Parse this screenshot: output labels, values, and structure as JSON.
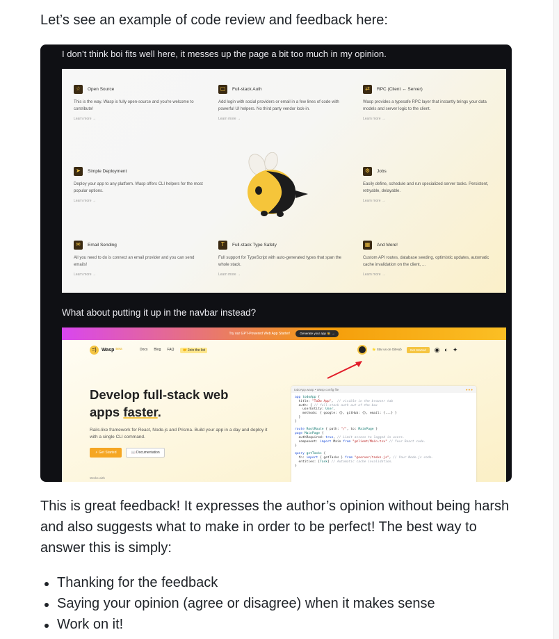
{
  "intro": "Let’s see an example of code review and feedback here:",
  "screenshot": {
    "comment1": "I don’t think boi fits well here, it messes up the page a bit too much in my opinion.",
    "comment2": "What about putting it up in the navbar instead?",
    "features": [
      {
        "icon": "star-icon",
        "glyph": "☆",
        "title": "Open Source",
        "desc": "This is the way. Wasp is fully open-source and you're welcome to contribute!",
        "more": "Learn more →"
      },
      {
        "icon": "lock-icon",
        "glyph": "▢",
        "title": "Full-stack Auth",
        "desc": "Add login with social providers or email in a few lines of code with powerful UI helpers. No third party vendor lock-in.",
        "more": "Learn more →"
      },
      {
        "icon": "rpc-icon",
        "glyph": "⇄",
        "title": "RPC (Client ↔ Server)",
        "desc": "Wasp provides a typesafe RPC layer that instantly brings your data models and server logic to the client.",
        "more": "Learn more →"
      },
      {
        "icon": "send-icon",
        "glyph": "➤",
        "title": "Simple Deployment",
        "desc": "Deploy your app to any platform. Wasp offers CLI helpers for the most popular options.",
        "more": "Learn more →"
      },
      {
        "icon": "gear-icon",
        "glyph": "⚙",
        "title": "Jobs",
        "desc": "Easily define, schedule and run specialized server tasks. Persistent, retryable, delayable.",
        "more": "Learn more →"
      },
      {
        "icon": "mail-icon",
        "glyph": "✉",
        "title": "Email Sending",
        "desc": "All you need to do is connect an email provider and you can send emails!",
        "more": "Learn more →"
      },
      {
        "icon": "type-icon",
        "glyph": "T",
        "title": "Full-stack Type Safety",
        "desc": "Full support for TypeScript with auto-generated types that span the whole stack.",
        "more": "Learn more →"
      },
      {
        "icon": "grid-icon",
        "glyph": "▦",
        "title": "And More!",
        "desc": "Custom API routes, database seeding, optimistic updates, automatic cache invalidation on the client, ...",
        "more": "Learn more →"
      }
    ],
    "navbar": {
      "banner_text": "Try our GPT-Powered Web App Starter!",
      "banner_button": "Generate your app 🐝 →",
      "logo_name": "Wasp",
      "logo_beta": "Beta",
      "links": [
        "Docs",
        "Blog",
        "FAQ"
      ],
      "join": "🤝 Join the list",
      "star": "⭐ Star us on GitHub",
      "get_started": "Get Started",
      "socials": "◉ ◐ ✦"
    },
    "hero": {
      "title_line1": "Develop full-stack web",
      "title_line2": "apps ",
      "title_underlined": "faster",
      "title_end": ".",
      "subtitle": "Rails-like framework for React, Node.js and Prisma. Build your app in a day and deploy it with a single CLI command.",
      "get_started": "⚡ Get Started",
      "documentation": "📖 Documentation",
      "works_with": "Works with"
    },
    "code": {
      "filename": "todoApp.wasp • Wasp config file",
      "dots": "●●●"
    }
  },
  "paragraph": "This is great feedback! It expresses the author’s opinion without being harsh and also suggests what to make in order to be perfect! The best way to answer this is simply:",
  "bullets": [
    "Thanking for the feedback",
    "Saying your opinion (agree or disagree) when it makes sense",
    "Work on it!"
  ]
}
